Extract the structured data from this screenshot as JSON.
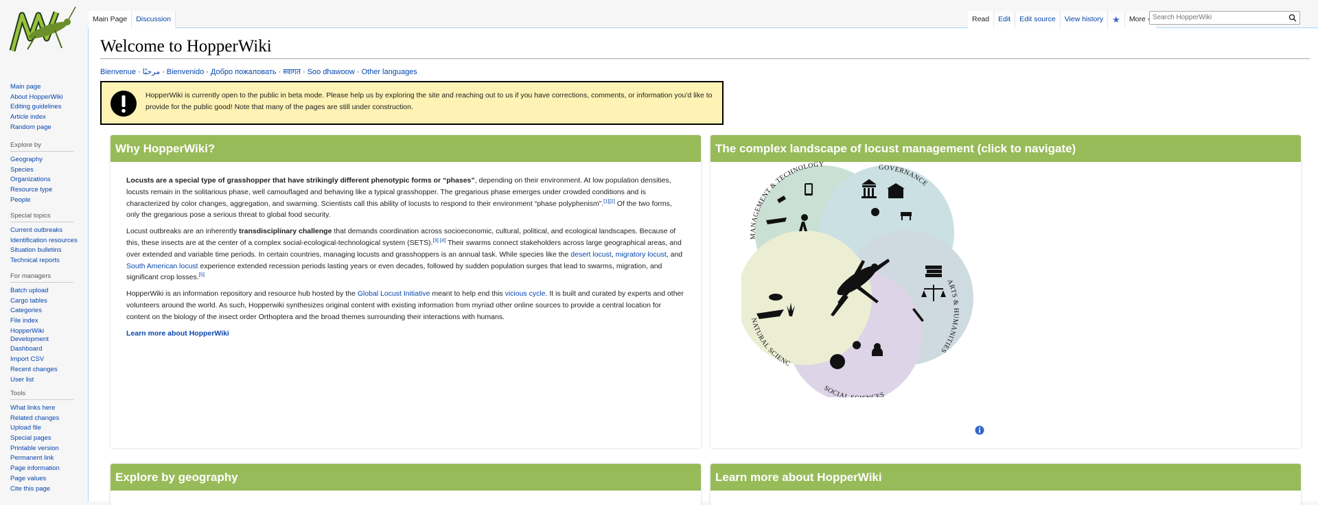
{
  "sidebar": {
    "main_links": [
      "Main page",
      "About HopperWiki",
      "Editing guidelines",
      "Article index",
      "Random page"
    ],
    "explore": {
      "heading": "Explore by",
      "items": [
        "Geography",
        "Species",
        "Organizations",
        "Resource type",
        "People"
      ]
    },
    "special": {
      "heading": "Special topics",
      "items": [
        "Current outbreaks",
        "Identification resources",
        "Situation bulletins",
        "Technical reports"
      ]
    },
    "managers": {
      "heading": "For managers",
      "items": [
        "Batch upload",
        "Cargo tables",
        "Categories",
        "File index",
        "HopperWiki Development",
        "Dashboard",
        "Import CSV",
        "Recent changes",
        "User list"
      ]
    },
    "tools": {
      "heading": "Tools",
      "items": [
        "What links here",
        "Related changes",
        "Upload file",
        "Special pages",
        "Printable version",
        "Permanent link",
        "Page information",
        "Page values",
        "Cite this page"
      ]
    }
  },
  "tabs": {
    "main_page": "Main Page",
    "discussion": "Discussion",
    "read": "Read",
    "edit": "Edit",
    "edit_source": "Edit source",
    "view_history": "View history",
    "more": "More"
  },
  "search": {
    "placeholder": "Search HopperWiki"
  },
  "page": {
    "title": "Welcome to HopperWiki",
    "languages": [
      "Bienvenue",
      "مرحبًا",
      "Bienvenido",
      "Добро пожаловать",
      "स्वागत",
      "Soo dhawoow",
      "Other languages"
    ],
    "notice": "HopperWiki is currently open to the public in beta mode. Please help us by exploring the site and reaching out to us if you have corrections, comments, or information you'd like to provide for the public good! Note that many of the pages are still under construction."
  },
  "why": {
    "heading": "Why HopperWiki?",
    "p1_bold": "Locusts are a special type of grasshopper that have strikingly different phenotypic forms or “phases”",
    "p1_rest": ", depending on their environment. At low population densities, locusts remain in the solitarious phase, well camouflaged and behaving like a typical grasshopper. The gregarious phase emerges under crowded conditions and is characterized by color changes, aggregation, and swarming. Scientists call this ability of locusts to respond to their environment “phase polyphenism”.",
    "p1_refs": "[1][2]",
    "p1_end": " Of the two forms, only the gregarious pose a serious threat to global food security.",
    "p2_a": "Locust outbreaks are an inherently ",
    "p2_bold": "transdisciplinary challenge",
    "p2_b": " that demands coordination across socioeconomic, cultural, political, and ecological landscapes. Because of this, these insects are at the center of a complex social-ecological-technological system (SETS).",
    "p2_refs": "[3] [4]",
    "p2_c": " Their swarms connect stakeholders across large geographical areas, and over extended and variable time periods. In certain countries, managing locusts and grasshoppers is an annual task. While species like the ",
    "link_desert": "desert locust",
    "link_migratory": "migratory locust",
    "p2_and": ", and ",
    "link_south": "South American locust",
    "p2_d": " experience extended recession periods lasting years or even decades, followed by sudden population surges that lead to swarms, migration, and significant crop losses.",
    "p2_refs2": "[5]",
    "p3_a": "HopperWiki is an information repository and resource hub hosted by the ",
    "link_gli": "Global Locust Initiative",
    "p3_b": " meant to help end this ",
    "link_vicious": "vicious cycle",
    "p3_c": ". It is built and curated by experts and other volunteers around the world. As such, Hopperwiki synthesizes original content with existing information from myriad other online sources to provide a central location for content on the biology of the insect order Orthoptera and the broad themes surrounding their interactions with humans.",
    "learn_more": "Learn more about HopperWiki"
  },
  "complex": {
    "heading": "The complex landscape of locust management (click to navigate)",
    "labels": {
      "mgmt": "MANAGEMENT & TECHNOLOGY",
      "gov": "GOVERNANCE",
      "arts": "ARTS & HUMANITIES",
      "social": "SOCIAL SCIENCES",
      "natural": "NATURAL SCIENCES"
    },
    "colors": {
      "mgmt": "#a8ccb8",
      "gov": "#a9cdd2",
      "arts": "#aec3cd",
      "social": "#c8b8d8",
      "natural": "#dfe4b6"
    }
  },
  "geo": {
    "heading": "Explore by geography"
  },
  "learn": {
    "heading": "Learn more about HopperWiki"
  }
}
